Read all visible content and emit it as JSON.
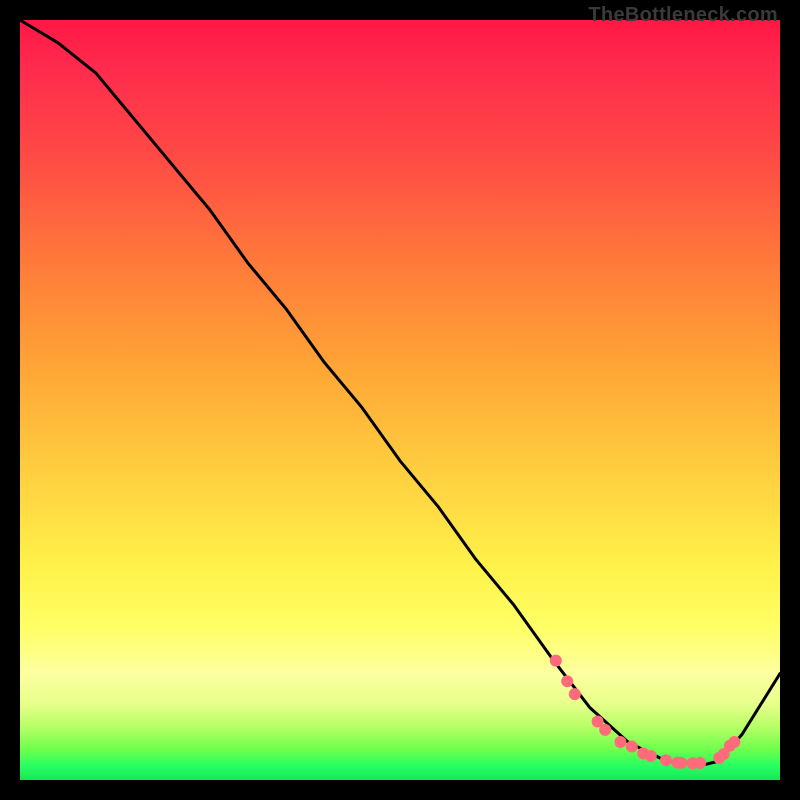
{
  "watermark": "TheBottleneck.com",
  "chart_data": {
    "type": "line",
    "title": "",
    "xlabel": "",
    "ylabel": "",
    "xlim": [
      0,
      100
    ],
    "ylim": [
      0,
      100
    ],
    "series": [
      {
        "name": "curve",
        "x": [
          0,
          5,
          10,
          15,
          20,
          25,
          30,
          35,
          40,
          45,
          50,
          55,
          60,
          65,
          70,
          75,
          80,
          85,
          90,
          92,
          95,
          100
        ],
        "values": [
          100,
          97,
          93,
          87,
          81,
          75,
          68,
          62,
          55,
          49,
          42,
          36,
          29,
          23,
          16,
          9.5,
          5,
          2.5,
          2,
          2.5,
          6,
          14
        ]
      }
    ],
    "markers": [
      {
        "x": 70.5,
        "y": 15.7
      },
      {
        "x": 72.0,
        "y": 13.0
      },
      {
        "x": 73.0,
        "y": 11.3
      },
      {
        "x": 76.0,
        "y": 7.7
      },
      {
        "x": 77.0,
        "y": 6.6
      },
      {
        "x": 79.0,
        "y": 5.0
      },
      {
        "x": 80.5,
        "y": 4.4
      },
      {
        "x": 82.0,
        "y": 3.5
      },
      {
        "x": 83.0,
        "y": 3.15
      },
      {
        "x": 85.0,
        "y": 2.6
      },
      {
        "x": 86.5,
        "y": 2.3
      },
      {
        "x": 87.0,
        "y": 2.25
      },
      {
        "x": 88.5,
        "y": 2.2
      },
      {
        "x": 89.5,
        "y": 2.25
      },
      {
        "x": 92.0,
        "y": 2.9
      },
      {
        "x": 92.6,
        "y": 3.4
      },
      {
        "x": 93.4,
        "y": 4.5
      },
      {
        "x": 94.0,
        "y": 5.0
      }
    ],
    "marker_color": "#ff6b7a",
    "curve_color": "#000000",
    "gradient_stops": [
      {
        "pos": 0,
        "color": "#ff1744"
      },
      {
        "pos": 50,
        "color": "#ffc040"
      },
      {
        "pos": 80,
        "color": "#ffff66"
      },
      {
        "pos": 100,
        "color": "#14e85a"
      }
    ]
  }
}
